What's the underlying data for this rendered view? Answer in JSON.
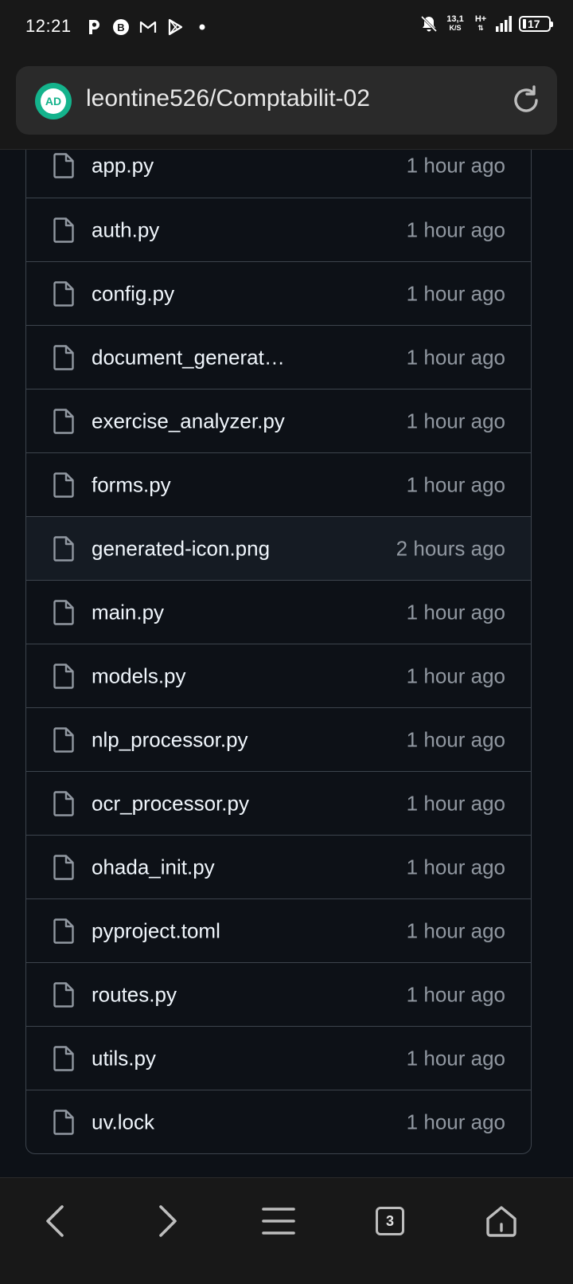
{
  "status_bar": {
    "time": "12:21",
    "net_speed_value": "13,1",
    "net_speed_unit": "K/S",
    "net_type": "H+",
    "battery": "17",
    "icons": [
      "p-app-icon",
      "b-app-icon",
      "gmail-icon",
      "play-store-icon",
      "dot-icon",
      "bell-off-icon",
      "signal-icon",
      "battery-icon"
    ]
  },
  "address_bar": {
    "badge_text": "AD",
    "url": "leontine526/Comptabilit-02"
  },
  "files": [
    {
      "name": "app.py",
      "time": "1 hour ago"
    },
    {
      "name": "auth.py",
      "time": "1 hour ago"
    },
    {
      "name": "config.py",
      "time": "1 hour ago"
    },
    {
      "name": "document_generat…",
      "time": "1 hour ago"
    },
    {
      "name": "exercise_analyzer.py",
      "time": "1 hour ago"
    },
    {
      "name": "forms.py",
      "time": "1 hour ago"
    },
    {
      "name": "generated-icon.png",
      "time": "2 hours ago"
    },
    {
      "name": "main.py",
      "time": "1 hour ago"
    },
    {
      "name": "models.py",
      "time": "1 hour ago"
    },
    {
      "name": "nlp_processor.py",
      "time": "1 hour ago"
    },
    {
      "name": "ocr_processor.py",
      "time": "1 hour ago"
    },
    {
      "name": "ohada_init.py",
      "time": "1 hour ago"
    },
    {
      "name": "pyproject.toml",
      "time": "1 hour ago"
    },
    {
      "name": "routes.py",
      "time": "1 hour ago"
    },
    {
      "name": "utils.py",
      "time": "1 hour ago"
    },
    {
      "name": "uv.lock",
      "time": "1 hour ago"
    }
  ],
  "bottom_nav": {
    "tab_count": "3"
  },
  "colors": {
    "background": "#0d1117",
    "border": "#3d444d",
    "text_primary": "#f0f6fc",
    "text_muted": "#9198a1",
    "badge": "#14b38c",
    "highlight_row": "#151b23"
  }
}
